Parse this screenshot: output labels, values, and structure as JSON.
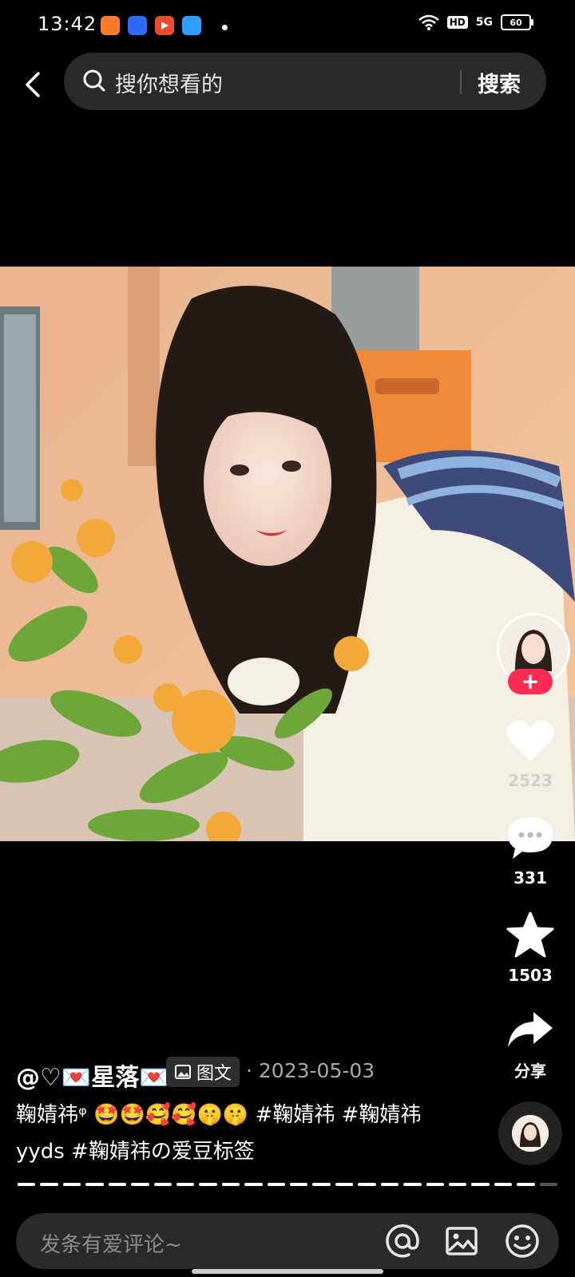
{
  "status_bar": {
    "time": "13:42",
    "network": "5G",
    "hd": "HD",
    "battery": "60"
  },
  "header": {
    "search_placeholder": "搜你想看的",
    "search_button": "搜索"
  },
  "post": {
    "author": "@♡💌星落💌",
    "type_badge": "图文",
    "date": "· 2023-05-03",
    "caption": "鞠婧祎ᵠ 🤩🤩🥰🥰🤫🤫 #鞠婧祎 #鞠婧祎yyds #鞠婧祎の爱豆标签",
    "image_count": 24,
    "current_image": 23
  },
  "actions": {
    "likes": "2523",
    "comments": "331",
    "favorites": "1503",
    "share": "分享"
  },
  "comment_input": {
    "placeholder": "发条有爱评论~"
  },
  "colors": {
    "accent": "#fe2c55",
    "background": "#000000"
  }
}
